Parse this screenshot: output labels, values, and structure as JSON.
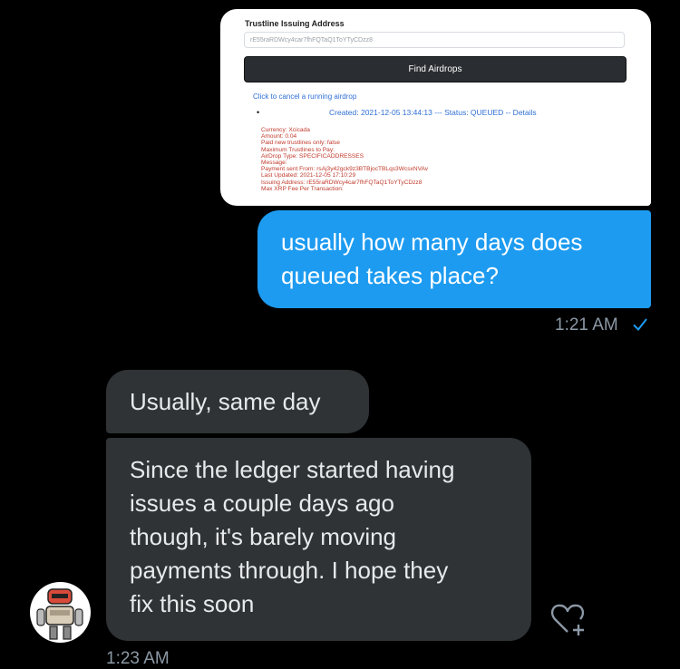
{
  "screenshot": {
    "label": "Trustline Issuing Address",
    "address_value": "rE55raRDWcy4car7fhFQTaQ1ToYTyCDzz8",
    "button_label": "Find Airdrops",
    "cancel_link": "Click to cancel a running airdrop",
    "bullet": "•",
    "created_line": "Created: 2021-12-05 13:44:13 --- Status: QUEUED -- Details",
    "detail_lines": [
      "Currency: Xcicada",
      "Amount: 0.04",
      "Paid new trustlines only: false",
      "Maximum Trustlines to Pay:",
      "AirDrop Type: SPECIFICADDRESSES",
      "Message:",
      "Payment sent From: rsAj3y42gck9z3BTBjocTBLqs3WcsxNVAv",
      "Last Updated: 2021-12-05 17:10:29",
      "Issuing Address: rE55raRDWcy4car7fhFQTaQ1ToYTyCDzz8",
      "Max XRP Fee Per Transaction:"
    ]
  },
  "messages": {
    "outgoing_text": "usually how many days does queued takes place?",
    "outgoing_lines": [
      "usually how many days does",
      "queued takes place?"
    ],
    "outgoing_time": "1:21 AM",
    "read_receipt_icon": "check-icon",
    "incoming_1": "Usually, same day",
    "incoming_2_lines": [
      "Since the ledger started having",
      "issues a couple days ago",
      "though, it's barely moving",
      "payments through.  I hope they",
      "fix this soon"
    ],
    "incoming_time": "1:23 AM"
  },
  "icons": {
    "avatar": "robot-avatar",
    "react": "heart-plus-icon"
  },
  "colors": {
    "background": "#000000",
    "outgoing_bubble": "#1d9bf0",
    "incoming_bubble": "#2f3336",
    "timestamp": "#8b98a5"
  }
}
